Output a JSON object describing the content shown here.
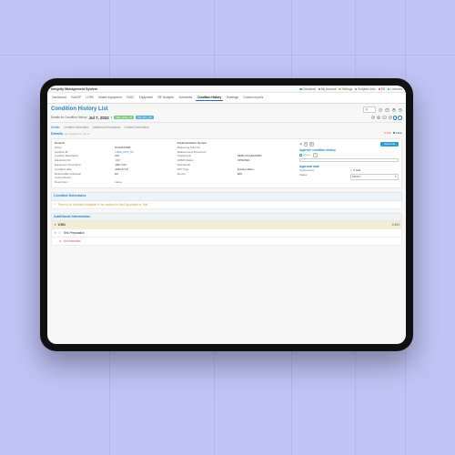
{
  "topbar": {
    "app_name": "Integrity Management System",
    "links": [
      "Download",
      "My Account",
      "Settings",
      "Scripted Jobs",
      "EN",
      "Licences"
    ]
  },
  "menu": {
    "items": [
      "Dashboard",
      "HAZOP",
      "LOPA",
      "Master equipment",
      "FASC",
      "Equipment",
      "SIF Analysis",
      "Schedules",
      "Condition History",
      "Drawings",
      "Custom reports"
    ],
    "active": "Condition History"
  },
  "page_title": "Condition History List",
  "detail_header": {
    "label": "Details for Condition History",
    "date": "Jul 7, 2022",
    "pill1": "WM_HCR_HV",
    "pill2": "DM_RC_HV"
  },
  "subtabs": [
    "Details",
    "Credited Schedules",
    "Additional Information",
    "Created Schedules"
  ],
  "details_panel": {
    "title": "Details",
    "meta": "Last updated by GG on",
    "edit": "Edit",
    "close": "Close"
  },
  "col1": {
    "heading": "General",
    "rows": [
      [
        "Name",
        "KCH0100DM"
      ],
      [
        "Location ID",
        "LOPA_DCV_VA"
      ],
      [
        "Location Description",
        "N/A"
      ],
      [
        "Equipment ID",
        "1007"
      ],
      [
        "Equipment Description",
        "1007-XX1"
      ],
      [
        "Condition date",
        "2022-07-07"
      ],
      [
        "Responsible individual",
        "Ed"
      ],
      [
        "Current Event",
        ""
      ],
      [
        "Description",
        "name"
      ]
    ]
  },
  "col2": {
    "heading": "Implementation System",
    "rows": [
      [
        "Measuring Point No",
        ""
      ],
      [
        "Measurement Document",
        ""
      ],
      [
        "Tracking No",
        "DEMO KCH0100DM"
      ],
      [
        "CMMS Status",
        "UPDATED"
      ],
      [
        "Test Result",
        ""
      ],
      [
        "RTF Type",
        "Routine Maint."
      ],
      [
        "Source",
        "IMS"
      ]
    ]
  },
  "side": {
    "approval_btn": "Approval",
    "sec1_title": "Approve condition history",
    "agree": "Agree",
    "sec2_title": "Approval data",
    "approved_by_k": "Approved by",
    "approved_by_v": "Edit",
    "status_k": "Status",
    "status_v": "DRAFT"
  },
  "credited": {
    "title": "Credited Schedules",
    "msg": "There is no schedule available to be credited in this Equipment or Test."
  },
  "addl": {
    "title": "Additional Information",
    "group": "V-001",
    "right_label": "V-001",
    "rows": [
      "Test Preparation",
      "Not executed"
    ]
  },
  "search_placeholder": "Q"
}
